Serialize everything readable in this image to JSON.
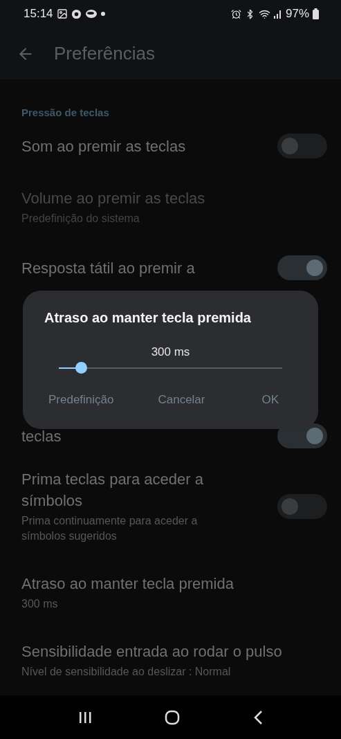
{
  "status_bar": {
    "time": "15:14",
    "battery": "97%"
  },
  "app_bar": {
    "title": "Preferências"
  },
  "section": {
    "label": "Pressão de teclas"
  },
  "rows": [
    {
      "kind": "toggle",
      "title": "Som ao premir as teclas",
      "on": false,
      "disabled": false
    },
    {
      "kind": "plain",
      "title": "Volume ao premir as teclas",
      "subtitle": "Predefinição do sistema",
      "disabled": true
    },
    {
      "kind": "toggle",
      "title": "Resposta tátil ao premir a",
      "on": true,
      "disabled": false
    },
    {
      "kind": "toggle",
      "title": "teclas",
      "on": true,
      "disabled": false,
      "partly_covered": true
    },
    {
      "kind": "toggle",
      "title": "Prima teclas para aceder a símbolos",
      "subtitle": "Prima continuamente para aceder a símbolos sugeridos",
      "on": false,
      "disabled": false
    },
    {
      "kind": "plain",
      "title": "Atraso ao manter tecla premida",
      "subtitle": "300 ms",
      "disabled": false
    },
    {
      "kind": "plain",
      "title": "Sensibilidade entrada ao rodar o pulso",
      "subtitle": "Nível de sensibilidade ao deslizar : Normal",
      "disabled": false
    }
  ],
  "dialog": {
    "title": "Atraso ao manter tecla premida",
    "reading": "300 ms",
    "level": 0.1,
    "buttons": [
      "Predefinição",
      "Cancelar",
      "OK"
    ]
  }
}
